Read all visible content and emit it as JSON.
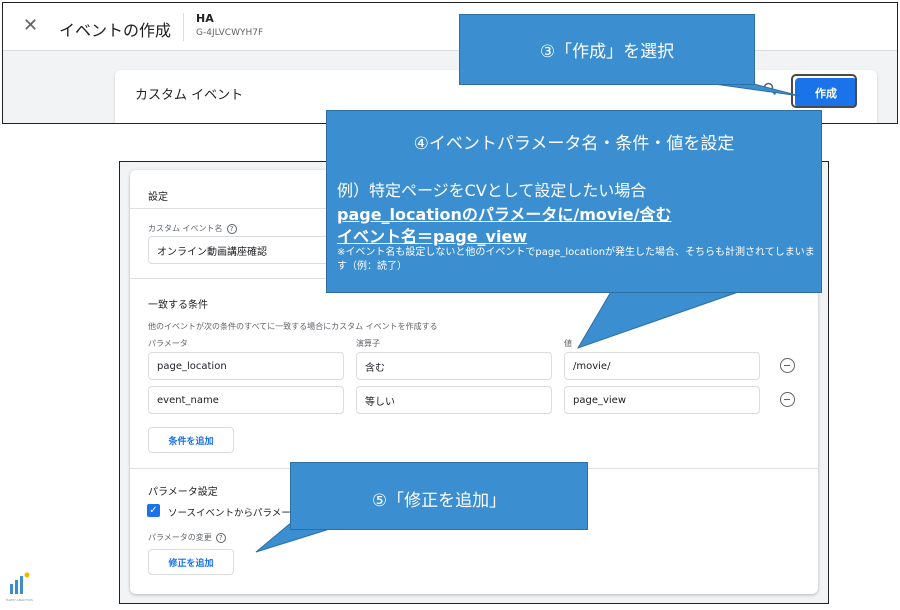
{
  "top": {
    "close_icon": "close-icon",
    "title": "イベントの作成",
    "property_name": "HA",
    "property_id": "G-4JLVCWYH7F",
    "card_title": "カスタム イベント",
    "search_icon": "search-icon",
    "create_label": "作成"
  },
  "settings": {
    "title": "設定",
    "event_name_label": "カスタム イベント名",
    "event_name_value": "オンライン動画講座確認",
    "match_title": "一致する条件",
    "match_desc": "他のイベントが次の条件のすべてに一致する場合にカスタム イベントを作成する",
    "col_param": "パラメータ",
    "col_operator": "演算子",
    "col_value": "値",
    "conditions": [
      {
        "param": "page_location",
        "operator": "含む",
        "value": "/movie/"
      },
      {
        "param": "event_name",
        "operator": "等しい",
        "value": "page_view"
      }
    ],
    "add_condition_label": "条件を追加",
    "param_settings_title": "パラメータ設定",
    "copy_params_label": "ソースイベントからパラメータをコピー",
    "param_change_label": "パラメータの変更",
    "add_modification_label": "修正を追加"
  },
  "callouts": {
    "step3": "③「作成」を選択",
    "step4_title": "④イベントパラメータ名・条件・値を設定",
    "step4_example": "例）特定ページをCVとして設定したい場合",
    "step4_line1": "page_locationのパラメータに/movie/含む",
    "step4_line2": "イベント名＝page_view",
    "step4_note": "※イベント名も設定しないと他のイベントでpage_locationが発生した場合、そちらも計測されてしまいます（例：読了）",
    "step5": "⑤「修正を追加」"
  },
  "logo_text": "HAPPY ANALYTICS",
  "colors": {
    "callout": "#3b8ed0",
    "primary": "#1a73e8"
  }
}
